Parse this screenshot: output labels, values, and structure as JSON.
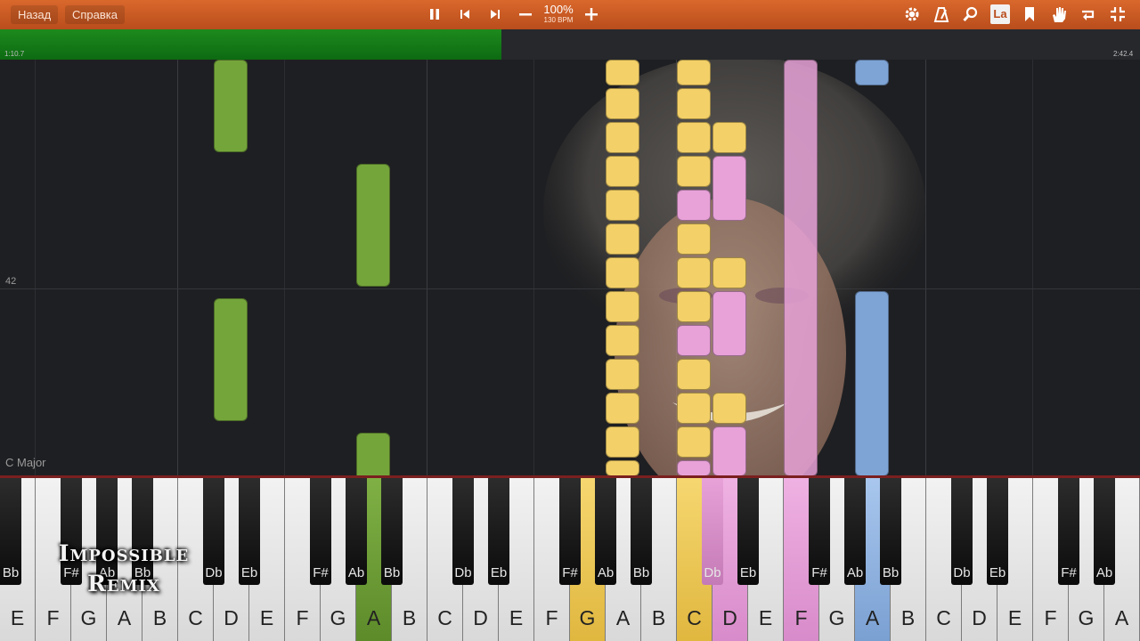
{
  "toolbar": {
    "back_label": "Назад",
    "help_label": "Справка",
    "speed_percent": "100%",
    "speed_bpm": "130 BPM",
    "label_mode_label": "La",
    "icons": [
      "pause-icon",
      "skip-back-icon",
      "skip-forward-icon",
      "minus-icon",
      "plus-icon",
      "gear-icon",
      "metronome-icon",
      "magnifier-icon",
      "label-icon",
      "bookmark-icon",
      "hand-icon",
      "loop-icon",
      "collapse-icon"
    ]
  },
  "timeline": {
    "current_time": "1:10.7",
    "total_time": "2:42.4",
    "progress": 0.44
  },
  "roll": {
    "measure_number": "42",
    "key_signature": "C Major"
  },
  "overlay": {
    "line1": "Impossible",
    "line2": "Remix"
  },
  "colors": {
    "toolbar": "#c95a24",
    "progress": "#178217",
    "green": "#74a53b",
    "yellow": "#f3d068",
    "pink": "#e8a2d8",
    "blue": "#7ea4d6"
  },
  "keyboard": {
    "white_labels": [
      "E",
      "F",
      "G",
      "A",
      "B",
      "C",
      "D",
      "E",
      "F",
      "G",
      "A",
      "B",
      "C",
      "D",
      "E",
      "F",
      "G",
      "A",
      "B",
      "C",
      "D",
      "E",
      "F",
      "G",
      "A",
      "B",
      "C",
      "D",
      "E",
      "F",
      "G",
      "A"
    ],
    "black_labels": [
      "Eb",
      "F#",
      "Ab",
      "Bb",
      "Db",
      "Eb",
      "F#",
      "Ab",
      "Bb",
      "Db",
      "Eb",
      "F#",
      "Ab",
      "Bb",
      "Db",
      "Eb",
      "F#",
      "Ab",
      "Bb",
      "Db",
      "Eb",
      "F#",
      "Ab",
      "Bb"
    ]
  }
}
